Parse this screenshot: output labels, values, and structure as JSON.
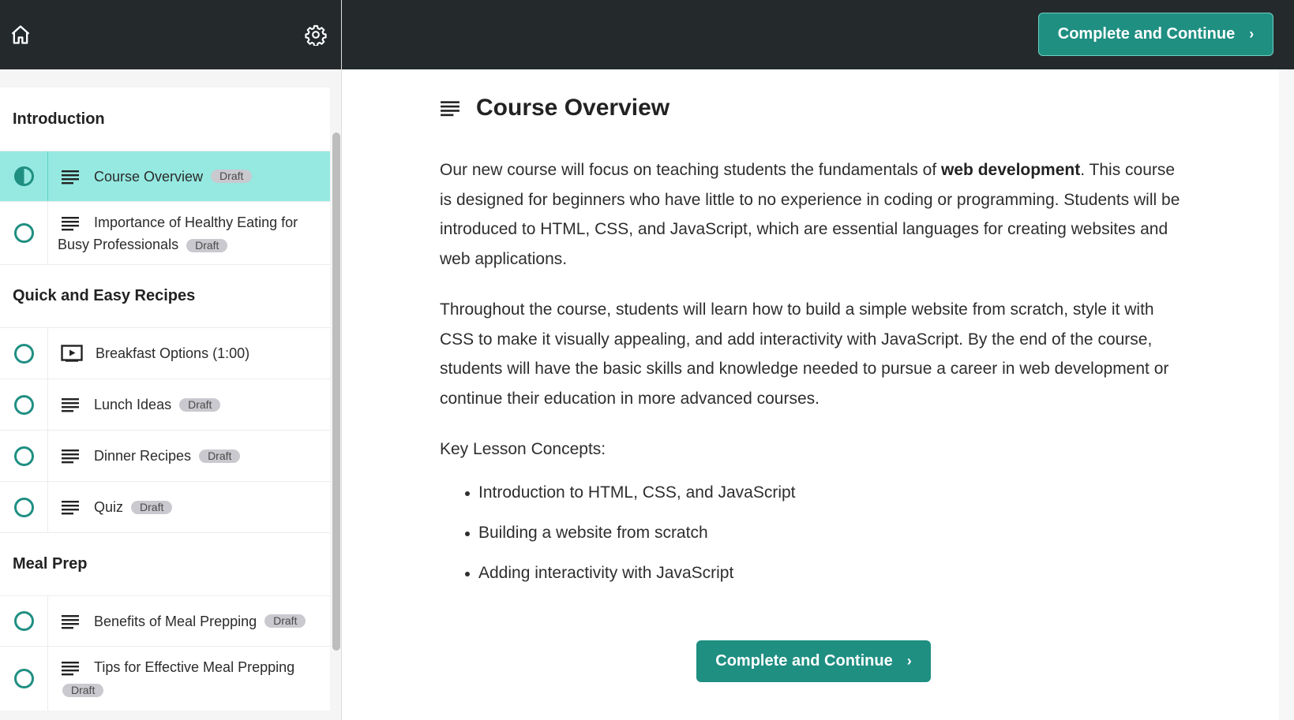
{
  "header": {
    "complete_label": "Complete and Continue",
    "chevron": "›"
  },
  "sidebar": {
    "sections": [
      {
        "title": "Introduction",
        "lessons": [
          {
            "label": "Course Overview",
            "badge": "Draft",
            "icon": "text-lines-icon",
            "status": "in-progress"
          },
          {
            "label": "Importance of Healthy Eating for Busy Professionals",
            "badge": "Draft",
            "icon": "text-lines-icon",
            "status": "not-started"
          }
        ]
      },
      {
        "title": "Quick and Easy Recipes",
        "lessons": [
          {
            "label": "Breakfast Options (1:00)",
            "badge": "",
            "icon": "video-icon",
            "status": "not-started"
          },
          {
            "label": "Lunch Ideas",
            "badge": "Draft",
            "icon": "text-lines-icon",
            "status": "not-started"
          },
          {
            "label": "Dinner Recipes",
            "badge": "Draft",
            "icon": "text-lines-icon",
            "status": "not-started"
          },
          {
            "label": "Quiz",
            "badge": "Draft",
            "icon": "text-lines-icon",
            "status": "not-started"
          }
        ]
      },
      {
        "title": "Meal Prep",
        "lessons": [
          {
            "label": "Benefits of Meal Prepping",
            "badge": "Draft",
            "icon": "text-lines-icon",
            "status": "not-started"
          },
          {
            "label": "Tips for Effective Meal Prepping",
            "badge": "Draft",
            "icon": "text-lines-icon",
            "status": "not-started"
          }
        ]
      }
    ]
  },
  "main": {
    "title": "Course Overview",
    "paragraph1_before": "Our new course will focus on teaching students the fundamentals of ",
    "paragraph1_bold": "web development",
    "paragraph1_after": ". This course is designed for beginners who have little to no experience in coding or programming. Students will be introduced to HTML, CSS, and JavaScript, which are essential languages for creating websites and web applications.",
    "paragraph2": "Throughout the course, students will learn how to build a simple website from scratch, style it with CSS to make it visually appealing, and add interactivity with JavaScript. By the end of the course, students will have the basic skills and knowledge needed to pursue a career in web development or continue their education in more advanced courses.",
    "concepts_heading": "Key Lesson Concepts:",
    "concepts": [
      "Introduction to HTML, CSS, and JavaScript",
      "Building a website from scratch",
      "Adding interactivity with JavaScript"
    ]
  },
  "colors": {
    "header_bg": "#242a2c",
    "accent": "#1f8f82",
    "active_row": "#95e9e1",
    "badge_bg": "#c9c9cf"
  }
}
